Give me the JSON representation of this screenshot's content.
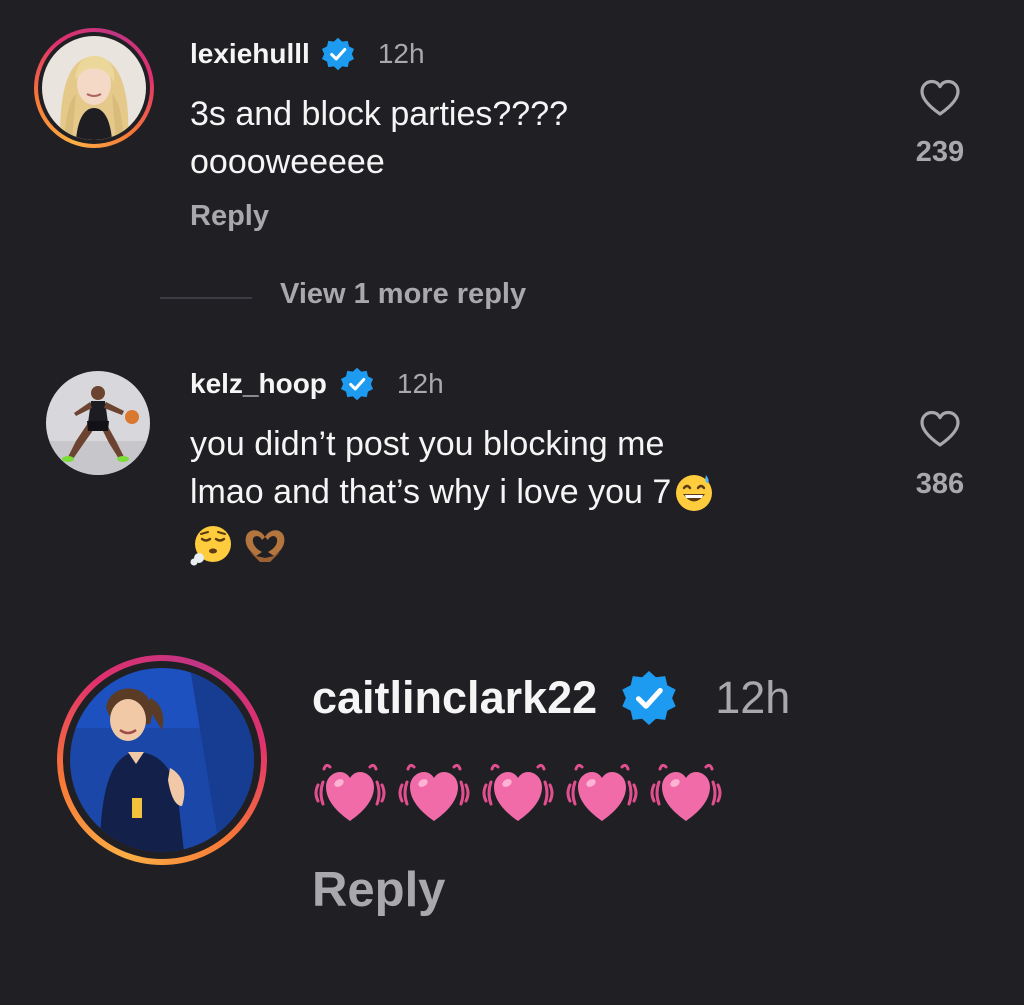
{
  "comments": [
    {
      "username": "lexiehulll",
      "verified": true,
      "time": "12h",
      "lines": [
        "3s and block parties????",
        "ooooweeeee"
      ],
      "reply_label": "Reply",
      "like_count": "239",
      "avatar_has_story_ring": true
    },
    {
      "username": "kelz_hoop",
      "verified": true,
      "time": "12h",
      "lines": [
        "you didn’t post you blocking me",
        "lmao and that’s why i love you 7"
      ],
      "emojis": [
        "grinning-sweat-emoji",
        "exhaling-emoji",
        "heart-hands-emoji"
      ],
      "like_count": "386",
      "avatar_has_story_ring": false
    },
    {
      "username": "caitlinclark22",
      "verified": true,
      "time": "12h",
      "emojis": [
        "beating-heart-emoji",
        "beating-heart-emoji",
        "beating-heart-emoji",
        "beating-heart-emoji",
        "beating-heart-emoji"
      ],
      "reply_label": "Reply",
      "avatar_has_story_ring": true
    }
  ],
  "view_more_replies": "View 1 more reply",
  "colors": {
    "background": "#202024",
    "primary_text": "#f5f5f5",
    "secondary_text": "#a8a8ad",
    "verified_blue": "#1d9bf0",
    "heart_pink": "#f06ba8"
  }
}
